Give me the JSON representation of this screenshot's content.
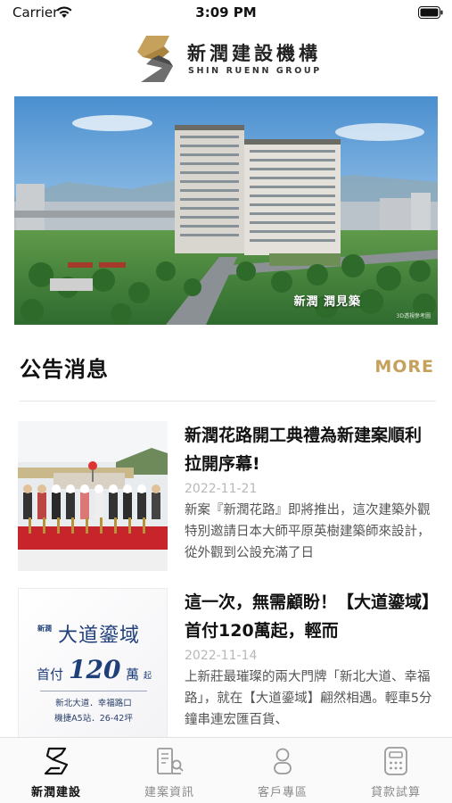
{
  "status_bar": {
    "carrier": "Carrier",
    "time": "3:09 PM"
  },
  "brand": {
    "name_cn": "新潤建設機構",
    "name_en": "SHIN RUENN GROUP",
    "accent_color": "#c6a15b"
  },
  "hero": {
    "caption": "新潤 潤見築",
    "note": "3D透視參考圖"
  },
  "announcements": {
    "title": "公告消息",
    "more_label": "MORE",
    "items": [
      {
        "title": "新潤花路開工典禮為新建案順利拉開序幕!",
        "date": "2022-11-21",
        "excerpt": "新案『新潤花路』即將推出，這次建築外觀特別邀請日本大師平原英樹建築師來設計，從外觀到公設充滿了日"
      },
      {
        "title": "這一次，無需顧盼！【大道鎏域】首付120萬起，輕而",
        "date": "2022-11-14",
        "excerpt": "上新莊最璀璨的兩大門牌「新北大道、幸福路」，就在【大道鎏域】翩然相遇。輕車5分鐘串連宏匯百貨、",
        "thumb": {
          "brand": "新潤",
          "name": "大道鎏域",
          "price_prefix": "首付",
          "price": "120",
          "price_unit": "萬",
          "price_suffix": "起",
          "location": "新北大道．幸福路口",
          "detail": "機捷A5站．26-42坪"
        }
      }
    ]
  },
  "tab_bar": {
    "tabs": [
      {
        "label": "新潤建設",
        "icon": "brand-logo-icon",
        "active": true
      },
      {
        "label": "建案資訊",
        "icon": "building-search-icon",
        "active": false
      },
      {
        "label": "客戶專區",
        "icon": "user-icon",
        "active": false
      },
      {
        "label": "貸款試算",
        "icon": "calculator-icon",
        "active": false
      }
    ]
  }
}
